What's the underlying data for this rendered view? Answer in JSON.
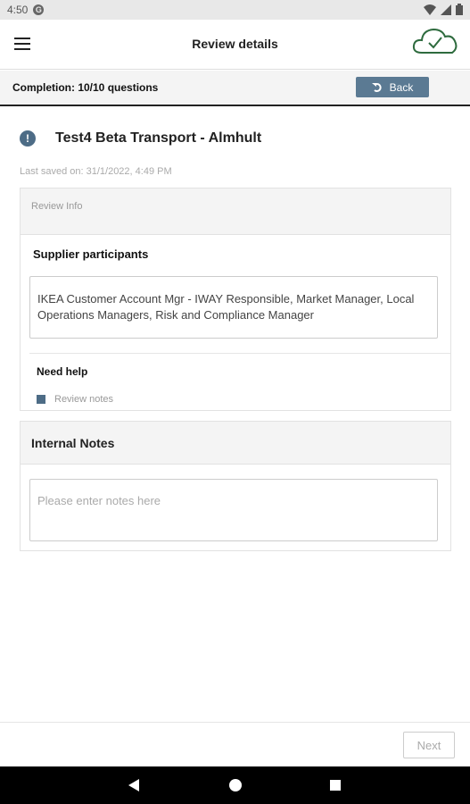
{
  "status_bar": {
    "time": "4:50",
    "g_badge": "G"
  },
  "app_bar": {
    "title": "Review details"
  },
  "completion": {
    "text": "Completion: 10/10 questions",
    "back_label": "Back"
  },
  "supplier": {
    "name": "Test4 Beta Transport - Almhult",
    "last_saved": "Last saved on: 31/1/2022, 4:49 PM"
  },
  "review_card": {
    "header": "Review Info",
    "participants_label": "Supplier participants",
    "participants_value": "IKEA Customer Account Mgr - IWAY Responsible,  Market Manager, Local Operations Managers, Risk and Compliance Manager",
    "need_help_label": "Need help",
    "review_notes_link": "Review notes"
  },
  "internal_notes": {
    "title": "Internal Notes",
    "placeholder": "Please enter notes here"
  },
  "footer": {
    "next_label": "Next"
  },
  "colors": {
    "accent": "#5b7a93",
    "cloud_green": "#2e6b3e",
    "info_blue": "#4d6c86"
  }
}
